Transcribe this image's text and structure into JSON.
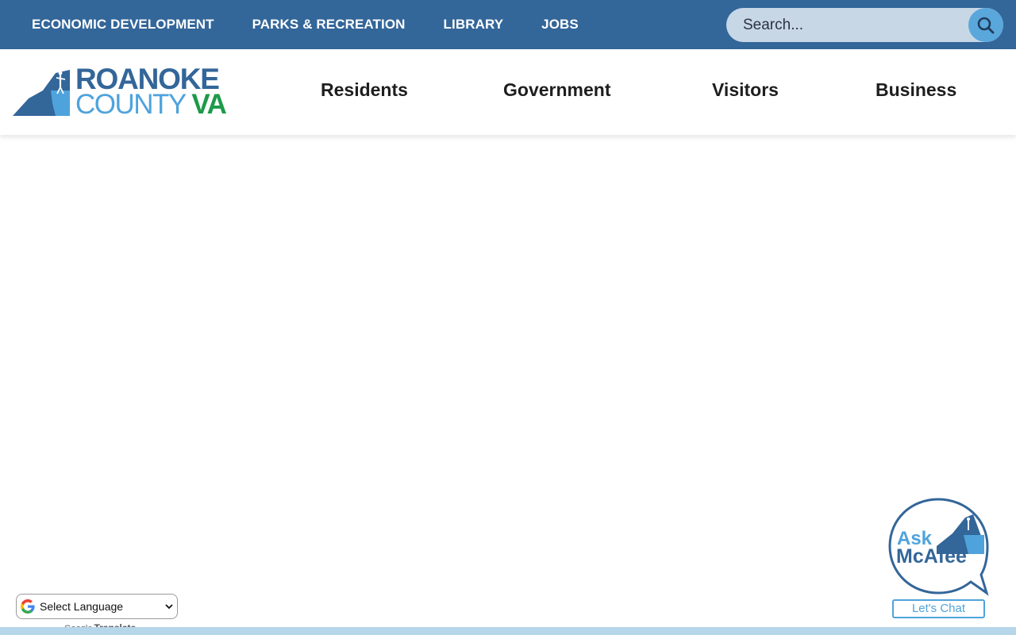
{
  "topbar": {
    "links": [
      "ECONOMIC DEVELOPMENT",
      "PARKS & RECREATION",
      "LIBRARY",
      "JOBS"
    ],
    "search_placeholder": "Search..."
  },
  "logo": {
    "line1": "ROANOKE",
    "line2_main": "COUNTY",
    "line2_accent": "VA"
  },
  "main_nav": {
    "items": [
      "Residents",
      "Government",
      "Visitors",
      "Business"
    ]
  },
  "translate": {
    "select_label": "Select Language",
    "powered_by": "Google",
    "powered_suffix": "Translate"
  },
  "chat": {
    "line1": "Ask",
    "line2": "McAfee",
    "button": "Let's Chat"
  },
  "colors": {
    "topbar": "#336699",
    "brand_dark": "#336699",
    "brand_light": "#4fa3dc",
    "brand_green": "#1c9a4a",
    "search_field": "#c8d7e6",
    "search_button": "#5aa7dc"
  },
  "icons": [
    "search-icon",
    "google-g-icon",
    "chevron-down-icon",
    "chat-bubble-icon",
    "hiker-icon"
  ]
}
